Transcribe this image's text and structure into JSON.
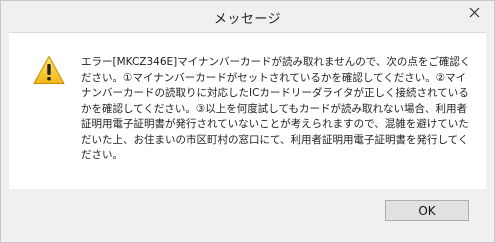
{
  "window": {
    "title": "メッセージ",
    "close_icon": "close-icon"
  },
  "dialog": {
    "icon": "warning-icon",
    "message": "エラー[MKCZ346E]マイナンバーカードが読み取れませんので、次の点をご確認ください。①マイナンバーカードがセットされているかを確認してください。②マイナンバーカードの読取りに対応したICカードリーダライタが正しく接続されているかを確認してください。③以上を何度試してもカードが読み取れない場合、利用者証明用電子証明書が発行されていないことが考えられますので、混雑を避けていただいた上、お住まいの市区町村の窓口にて、利用者証明用電子証明書を発行してください。",
    "ok_label": "OK"
  },
  "colors": {
    "warning_yellow": "#f5c518",
    "background": "#f0f0f0",
    "content_bg": "#ffffff"
  }
}
